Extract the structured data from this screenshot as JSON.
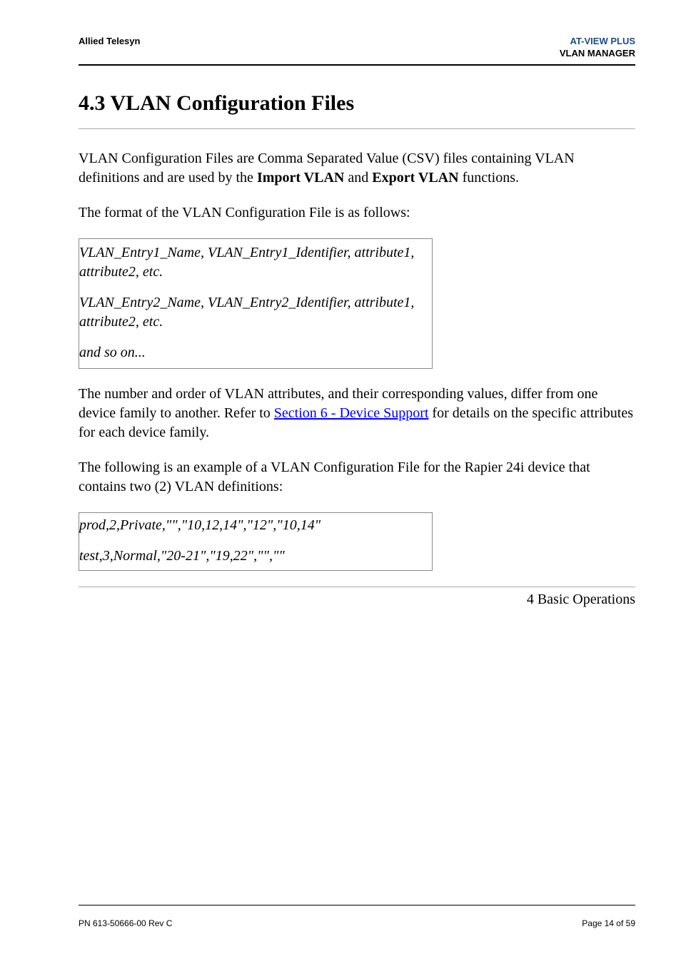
{
  "header": {
    "left": "Allied Telesyn",
    "right_line1": "AT-VIEW PLUS",
    "right_line2": "VLAN MANAGER"
  },
  "section_title": "4.3 VLAN Configuration Files",
  "para1_a": "VLAN Configuration Files are Comma Separated Value (CSV) files containing VLAN definitions and are used by the ",
  "para1_bold1": "Import VLAN",
  "para1_mid": " and ",
  "para1_bold2": "Export VLAN",
  "para1_end": " functions.",
  "para2": "The format of the VLAN Configuration File is as follows:",
  "codebox1": {
    "line1": "VLAN_Entry1_Name, VLAN_Entry1_Identifier, attribute1, attribute2, etc.",
    "line2": "VLAN_Entry2_Name, VLAN_Entry2_Identifier, attribute1, attribute2, etc.",
    "line3": "and so on..."
  },
  "para3_a": "The number and order of VLAN attributes, and their corresponding values, differ from one device family to another. Refer to ",
  "para3_link": "Section 6 - Device Support",
  "para3_b": " for details on the specific attributes for each device family.",
  "para4": "The following is an example of a VLAN Configuration File for the Rapier 24i device that contains two (2) VLAN definitions:",
  "codebox2": {
    "line1": "prod,2,Private,\"\",\"10,12,14\",\"12\",\"10,14\"",
    "line2": "test,3,Normal,\"20-21\",\"19,22\",\"\",\"\""
  },
  "chapter_ref": "4 Basic Operations",
  "footer": {
    "left": "PN 613-50666-00 Rev C",
    "right": "Page 14 of 59"
  }
}
